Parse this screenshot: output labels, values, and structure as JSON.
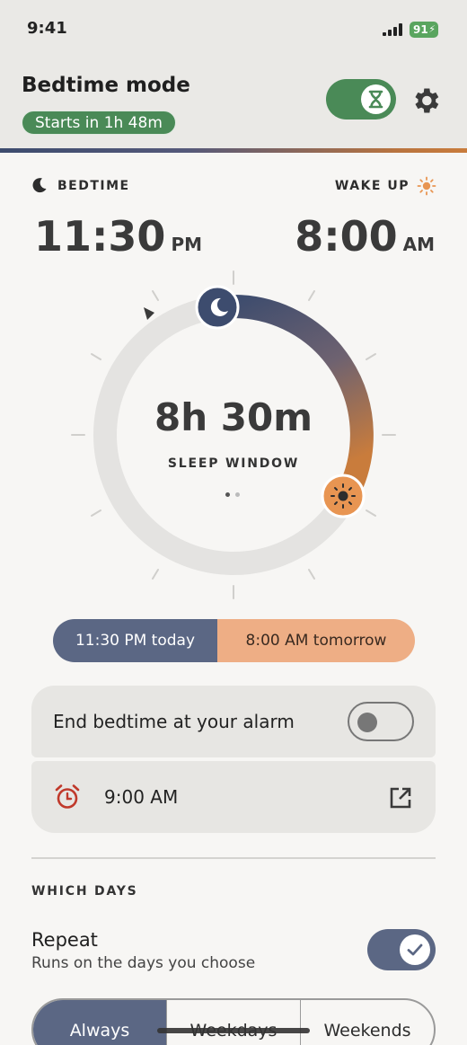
{
  "status": {
    "time": "9:41",
    "battery": "91"
  },
  "header": {
    "title": "Bedtime mode",
    "badge": "Starts in 1h 48m"
  },
  "bedtime": {
    "label": "BEDTIME",
    "time": "11:30",
    "ampm": "PM"
  },
  "wake": {
    "label": "WAKE UP",
    "time": "8:00",
    "ampm": "AM"
  },
  "dial": {
    "duration": "8h 30m",
    "caption": "SLEEP WINDOW"
  },
  "range": {
    "start": "11:30 PM today",
    "end": "8:00 AM tomorrow"
  },
  "settings": {
    "end_at_alarm": "End bedtime at your alarm",
    "alarm_time": "9:00 AM"
  },
  "days": {
    "section": "WHICH DAYS",
    "repeat_title": "Repeat",
    "repeat_sub": "Runs on the days you choose",
    "options": [
      "Always",
      "Weekdays",
      "Weekends"
    ]
  },
  "colors": {
    "accent_green": "#4a8a57",
    "night": "#3d4c6e",
    "sunrise": "#c97c3c",
    "peach": "#eeae85"
  },
  "icons": [
    "moon-icon",
    "sun-icon",
    "hourglass-icon",
    "gear-icon",
    "alarm-clock-icon",
    "external-link-icon",
    "check-icon"
  ]
}
